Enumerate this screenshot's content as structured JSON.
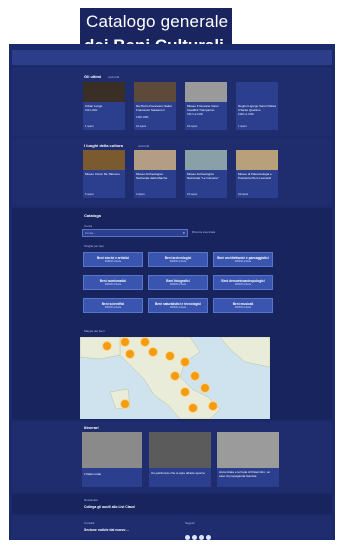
{
  "header": {
    "line1": "Catalogo generale",
    "line2": "dei Beni Culturali"
  },
  "latest": {
    "title": "Gli ultimi",
    "more": "vedi tutti",
    "cards": [
      {
        "title": "Urban Lungo",
        "date": "1921-1992",
        "foot": "1 opere"
      },
      {
        "title": "Da Pietro Francesco Saluti Francesco Sassano il",
        "date": "1990-1996",
        "foot": "16 opere"
      },
      {
        "title": "Museo Il Giovane Vanni Cavallini Trampanno",
        "date": "1847-ca.1996",
        "foot": "24 opere"
      },
      {
        "title": "Negrini Ligurgo Vanni Palma Il Santo Quartino",
        "date": "1990 ca.1996",
        "foot": "1 opere"
      }
    ]
  },
  "places": {
    "title": "I luoghi della cultura",
    "more": "vedi tutti",
    "cards": [
      {
        "title": "Museo Civico Re Talmone",
        "foot": "5 opere"
      },
      {
        "title": "Museo Archeologico Nazionale della Marche",
        "foot": "3 opere"
      },
      {
        "title": "Museo Archeologico Nazionale \"Le Camerie\"",
        "foot": "23 opere"
      },
      {
        "title": "Museo di Paleontologia e Preistoria Piero Leonardi",
        "foot": "34 opere"
      }
    ]
  },
  "catalogue": {
    "title": "Cataloga",
    "search_label": "Cerca",
    "search_placeholder": "Cerca...",
    "advanced": "Ricerca avanzata",
    "browse_label": "Sfoglia per tipo",
    "categories": [
      {
        "title": "Beni storici e artistici",
        "sub": "000000 schede"
      },
      {
        "title": "Beni archeologici",
        "sub": "000000 schede"
      },
      {
        "title": "Beni architettonici e paesaggistici",
        "sub": "000000 schede"
      },
      {
        "title": "Beni numismatici",
        "sub": "000000 schede"
      },
      {
        "title": "Beni fotografici",
        "sub": "000000 schede"
      },
      {
        "title": "Beni demoetnoantropologici",
        "sub": "000000 schede"
      },
      {
        "title": "Beni scientifici",
        "sub": "000000 schede"
      },
      {
        "title": "Beni naturalistici e tecnologici",
        "sub": "000000 schede"
      },
      {
        "title": "Beni musicali",
        "sub": "000000 schede"
      }
    ],
    "map_label": "Mappa dei beni"
  },
  "discover": {
    "title": "Itinerari",
    "cards": [
      {
        "title": "L'Italia rurale"
      },
      {
        "title": "Un patrimonio che si apre all'arte sporca"
      },
      {
        "title": "Annunziata e la Fede di Palermitro: un caso di propaganda fascista"
      }
    ]
  },
  "newsletter": {
    "label": "Newsletter",
    "text": "Collega gli ausili allo Livi Claud"
  },
  "footer": {
    "label": "Contatti",
    "link": "Sezione notizie dal nuovo ...",
    "social_label": "Seguici"
  },
  "colors": {
    "page_bg": "#1b2a6b",
    "card": "#2b3f8e",
    "accent": "#f39c12"
  }
}
